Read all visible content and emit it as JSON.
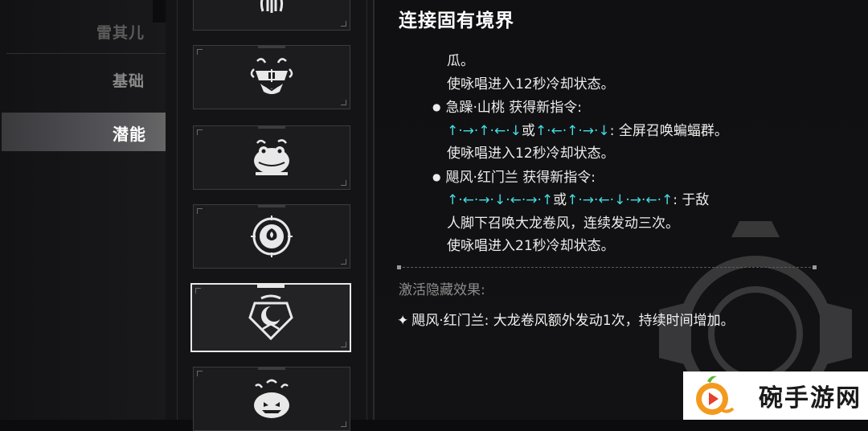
{
  "sidebar": {
    "items": [
      {
        "label": "雷其儿"
      },
      {
        "label": "基础"
      },
      {
        "label": "潜能"
      }
    ]
  },
  "cards": [
    {
      "icon": "tentacle-emblem-icon"
    },
    {
      "icon": "cat-face-icon"
    },
    {
      "icon": "toad-icon"
    },
    {
      "icon": "rose-seal-icon"
    },
    {
      "icon": "crescent-crest-icon",
      "selected": true
    },
    {
      "icon": "pumpkin-icon"
    }
  ],
  "detail": {
    "title": "连接固有境界",
    "line1": "瓜。",
    "line2": "使咏唱进入12秒冷却状态。",
    "b1_head": "急躁·山桃 获得新指令:",
    "b1_cmd1": "↑·→·↑·←·↓",
    "b1_or": "或",
    "b1_cmd2": "↑·←·↑·→·↓",
    "b1_effect": ": 全屏召唤蝙蝠群。",
    "b1_cd": "使咏唱进入12秒冷却状态。",
    "b2_head": "飓风·红门兰 获得新指令:",
    "b2_cmd1": "↑·←·→·↓·←·→·↑",
    "b2_or": "或",
    "b2_cmd2": "↑·→·←·↓·→·←·↑",
    "b2_effect": ": 于敌",
    "b2_effect2": "人脚下召唤大龙卷风，连续发动三次。",
    "b2_cd": "使咏唱进入21秒冷却状态。",
    "hidden_head": "激活隐藏效果:",
    "hidden_star": "✦",
    "hidden_line": "飓风·红门兰: 大龙卷风额外发动1次，持续时间增加。"
  },
  "watermark": {
    "text": "碗手游网"
  },
  "colors": {
    "accent": "#43dce4",
    "background": "#0c0c0e"
  }
}
